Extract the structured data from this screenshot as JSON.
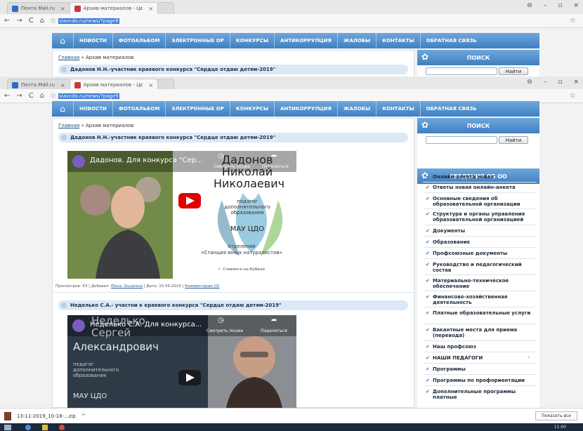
{
  "browser": {
    "tab_mail": "Почта Mail.ru",
    "tab_archive": "Архив материалов - Цє",
    "url": "slavcdo.ru/news/?page9",
    "tab_close": "×",
    "star": "☆",
    "win_controls": [
      "⊖",
      "–",
      "▫",
      "×"
    ],
    "nav_icons": [
      "←",
      "→",
      "C",
      "⌂",
      "ⓘ"
    ]
  },
  "nav": {
    "home": "⌂",
    "items": [
      "НОВОСТИ",
      "ФОТОАЛЬБОМ",
      "ЭЛЕКТРОННЫЕ ОР",
      "КОНКУРСЫ",
      "АНТИКОРРУПЦИЯ",
      "ЖАЛОБЫ",
      "КОНТАКТЫ",
      "ОБРАТНАЯ СВЯЗЬ"
    ]
  },
  "breadcrumb": {
    "home": "Главная",
    "sep": " » ",
    "current": "Архив материалов"
  },
  "articles": [
    {
      "title": "Дадонов Н.Н.-участник краевого конкурса \"Сердце отдаю детям-2019\"",
      "video_title": "Дадонов. Для конкурса \"Сер...",
      "watch_later": "Смотреть позже",
      "share": "Поделиться",
      "name_lines": [
        "Дадонов",
        "Николай",
        "Николаевич"
      ],
      "role": [
        "педагог",
        "дополнительного",
        "образования"
      ],
      "org": "МАУ ЦДО",
      "dept": [
        "отделение",
        "«Станция юных натуралистов»"
      ],
      "city": "г. Славянск-на-Кубани",
      "meta": {
        "views_label": "Просмотров: 63 | Добавил: ",
        "author": "Elena_Slusareva",
        "date_label": " | Дата: 15.04.2019 | ",
        "comments": "Комментарии (0)"
      }
    },
    {
      "title": "Неделько С.А.- участни к краевого конкурса \"Сердце отдаю детям-2019\"",
      "video_title": "Неделько С.А. Для конкурса...",
      "watch_later": "Смотреть позже",
      "share": "Поделиться",
      "name_lines": [
        "Неделько",
        "Сергей",
        "Александрович"
      ],
      "role": [
        "педагог",
        "дополнительного",
        "образования"
      ],
      "org": "МАУ ЦДО"
    }
  ],
  "sidebar": {
    "search_title": "ПОИСК",
    "search_button": "Найти",
    "info_title": "СВЕДЕНИЯ ОБ ОО",
    "menu": [
      "Онлайн-анкета новая",
      "Ответы новая онлайн-анкета",
      "Основные сведения об образовательной организации",
      "Структура и органы управления образовательной организацией",
      "Документы",
      "Образование",
      "Профсоюзные документы",
      "Руководство и педагогический состав",
      "Материально-техническое обеспечение",
      "Финансово-хозяйственная деятельность",
      "Платные образовательные услуги",
      "Вакантные места для приема (перевода)",
      "Наш профсоюз",
      "НАШИ ПЕДАГОГИ",
      "Программы",
      "Программы по профориентации",
      "Дополнительные программы платные"
    ]
  },
  "download": {
    "file": "13-11-2019_10-18-...zip",
    "chevron": "^",
    "show_all": "Показать все"
  },
  "taskbar": {
    "time": "11:00"
  },
  "colors": {
    "nav": "#3f7fc2",
    "header_band": "#dbe9f7",
    "play": "#e00000"
  }
}
